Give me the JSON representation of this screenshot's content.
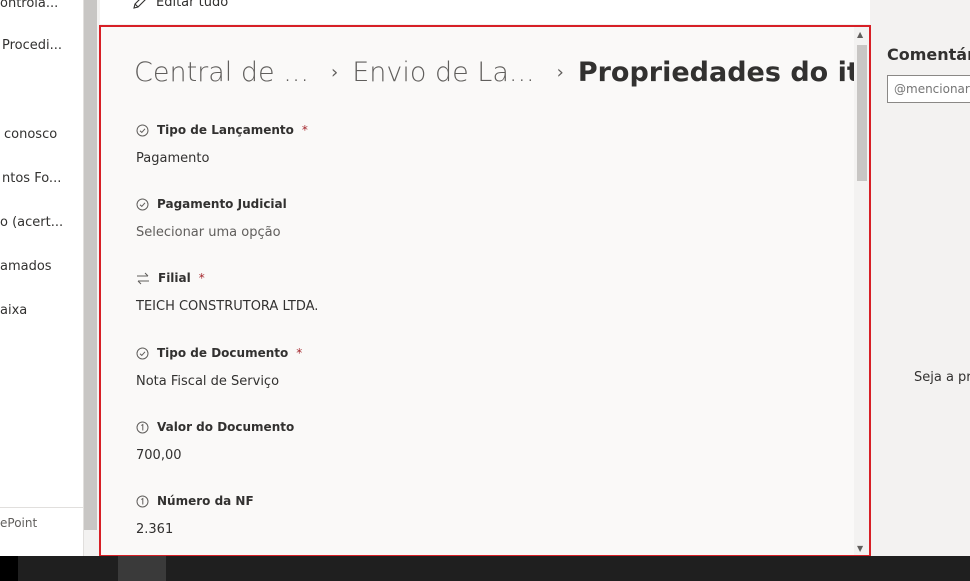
{
  "left_nav": {
    "items": [
      "ontrola...",
      "Procedi...",
      "conosco",
      "ntos Fo...",
      "o (acert...",
      "amados",
      "aixa"
    ],
    "footer": "ePoint"
  },
  "toolbar": {
    "edit_all": "Editar tudo"
  },
  "breadcrumb": [
    {
      "label": "Central de ..."
    },
    {
      "label": "Envio de La..."
    },
    {
      "label": "Propriedades do item"
    }
  ],
  "fields": [
    {
      "label": "Tipo de Lançamento",
      "required": "*",
      "value": "Pagamento",
      "icon": "check-circle-icon"
    },
    {
      "label": "Pagamento Judicial",
      "required": "",
      "value": "Selecionar uma opção",
      "icon": "check-circle-icon"
    },
    {
      "label": "Filial",
      "required": "*",
      "value": "TEICH CONSTRUTORA LTDA.",
      "icon": "lookup-arrows-icon"
    },
    {
      "label": "Tipo de Documento",
      "required": "*",
      "value": "Nota Fiscal de Serviço",
      "icon": "check-circle-icon"
    },
    {
      "label": "Valor do Documento",
      "required": "",
      "value": "700,00",
      "icon": "number-icon"
    },
    {
      "label": "Número da NF",
      "required": "",
      "value": "2.361",
      "icon": "number-icon"
    }
  ],
  "comments": {
    "title": "Comentári",
    "placeholder": "@mencionar",
    "first_text": "Seja a pri"
  },
  "colors": {
    "highlight_border": "#d71f26",
    "required": "#a4262c"
  }
}
